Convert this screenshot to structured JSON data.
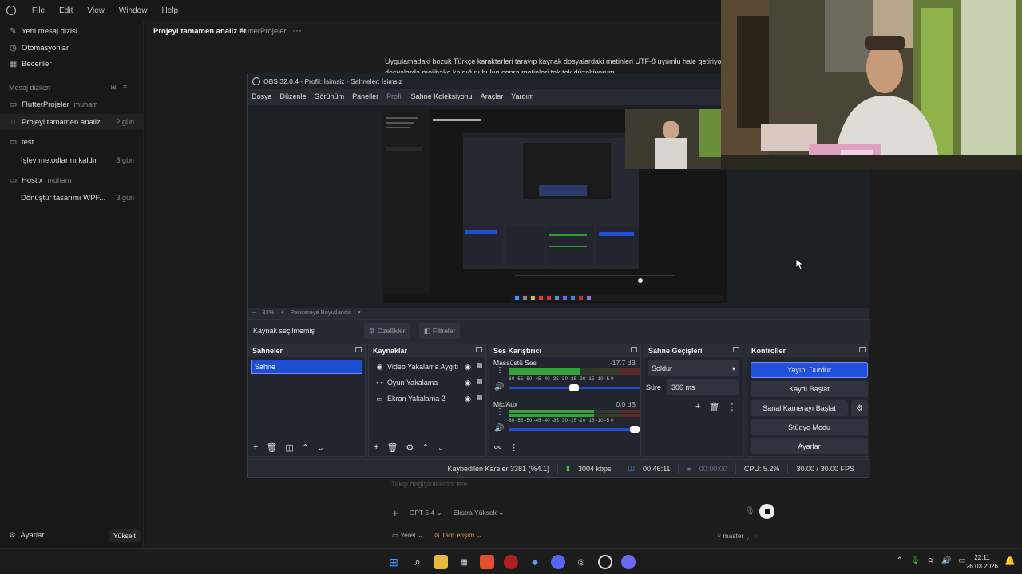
{
  "menubar": {
    "items": [
      "File",
      "Edit",
      "View",
      "Window",
      "Help"
    ]
  },
  "sidebar": {
    "top": [
      {
        "label": "Yeni mesaj dizisi",
        "icon": "compose-icon"
      },
      {
        "label": "Otomasyonlar",
        "icon": "clock-icon"
      },
      {
        "label": "Beceriler",
        "icon": "grid-icon"
      }
    ],
    "section_label": "Mesaj dizileri",
    "projects": [
      {
        "name": "FlutterProjeler",
        "owner": "muham"
      },
      {
        "name": "test",
        "owner": ""
      },
      {
        "name": "Hostix",
        "owner": "muham"
      }
    ],
    "threads": [
      {
        "label": "Projeyi tamamen analiz...",
        "age": "2 gün"
      },
      {
        "label": "İşlev metodlarını kaldır",
        "age": "3 gün"
      },
      {
        "label": "Dönüştür tasarımı WPF...",
        "age": "3 gün"
      }
    ],
    "settings_label": "Ayarlar",
    "upgrade_label": "Yükselt"
  },
  "main": {
    "thread_title": "Projeyi tamamen analiz et",
    "thread_project": "FlutterProjeler",
    "more": "···",
    "message_line1": "Uygulamadaki bozuk Türkçe karakterleri tarayıp kaynak dosyalardaki metinleri UTF-8 uyumlu hale getiriyorum.",
    "message_line2": "dosyalarda mojibake kaldığını bulup sonra metinleri tek tek düzeltiyorum.",
    "composer_hint": "Takip değişikliklerini iste",
    "model": "GPT-5.4",
    "effort": "Ekstra Yüksek",
    "env": "Yerel",
    "access": "Tam erişim",
    "branch": "master"
  },
  "obs": {
    "title": "OBS 32.0.4 - Profil: İsimsiz - Sahneler: İsimsiz",
    "menu": [
      "Dosya",
      "Düzenle",
      "Görünüm",
      "Paneller",
      "Profil",
      "Sahne Koleksiyonu",
      "Araçlar",
      "Yardım"
    ],
    "menu_disabled": "Profil",
    "zoom": "33%",
    "fit_label": "Pencereye Boyutlandır",
    "no_source": "Kaynak seçilmemiş",
    "properties": "Özellikler",
    "filters": "Filtreler",
    "docks": {
      "scenes": {
        "title": "Sahneler",
        "items": [
          "Sahne"
        ]
      },
      "sources": {
        "title": "Kaynaklar",
        "items": [
          {
            "label": "Video Yakalama Aygıtı",
            "icon": "camera-icon"
          },
          {
            "label": "Oyun Yakalama",
            "icon": "gamepad-icon"
          },
          {
            "label": "Ekran Yakalama 2",
            "icon": "monitor-icon"
          }
        ]
      },
      "mixer": {
        "title": "Ses Karıştırıcı",
        "channels": [
          {
            "name": "Masaüstü Ses",
            "db": "-17.7 dB",
            "level": 0.55,
            "volume": 0.5
          },
          {
            "name": "Mic/Aux",
            "db": "0.0 dB",
            "level": 0.65,
            "volume": 1.0
          }
        ],
        "scale": "-60 -55 -50 -45 -40 -35 -30 -25 -20 -15 -10 -5 0"
      },
      "transitions": {
        "title": "Sahne Geçişleri",
        "selected": "Soldur",
        "duration_label": "Süre",
        "duration": "300 ms"
      },
      "controls": {
        "title": "Kontroller",
        "buttons": [
          "Yayını Durdur",
          "Kaydı Başlat",
          "Sanal Kamerayı Başlat",
          "Stüdyo Modu",
          "Ayarlar"
        ]
      }
    },
    "status": {
      "dropped": "Kaybedilen Kareler 3381 (%4.1)",
      "bitrate": "3004 kbps",
      "stream_time": "00:46:11",
      "rec_time": "00:00:00",
      "cpu": "CPU: 5.2%",
      "fps": "30.00 / 30.00 FPS"
    }
  },
  "taskbar": {
    "time": "22:11",
    "date": "26.03.2026"
  },
  "colors": {
    "accent": "#2150d9",
    "orange": "#e8954a"
  }
}
